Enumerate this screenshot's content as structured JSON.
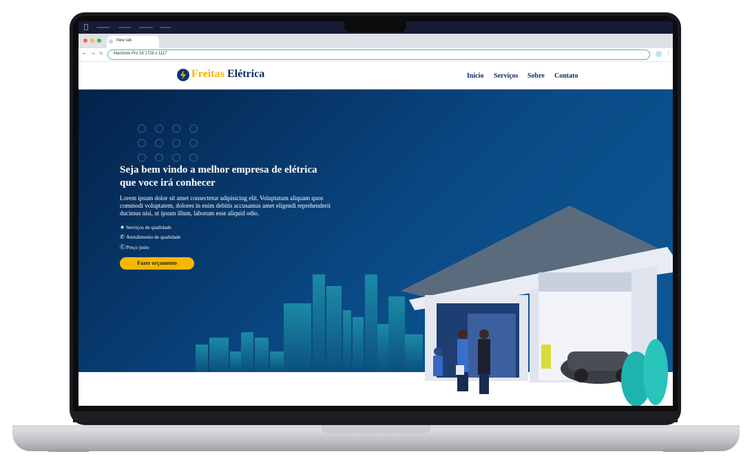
{
  "browser": {
    "tab_title": "New tab",
    "url": "Macbook Pro 16  1728 x 1117"
  },
  "site": {
    "logo": {
      "part1": "Freitas",
      "part2": "Elétrica"
    },
    "nav": [
      "Inicio",
      "Serviços",
      "Sobre",
      "Contato"
    ]
  },
  "hero": {
    "title": "Seja bem vindo a melhor empresa de elétrica que voce irá conhecer",
    "text": "Lorem ipsum dolor sit amet consectetur adipisicing elit. Voluptatum aliquam quos commodi voluptatem, dolores in enim debitis accusamus amet eligendi reprehenderit ducimus nisi, ut ipsum illum, laborum esse aliquid odio.",
    "features": [
      {
        "icon": "star-icon",
        "label": "Serviços de qualidade"
      },
      {
        "icon": "phone-icon",
        "label": "Atendimento de qualidade"
      },
      {
        "icon": "dollar-icon",
        "label": "Preço justo"
      }
    ],
    "cta": "Fazer orçamento"
  },
  "colors": {
    "hero_dark": "#04224a",
    "hero_light": "#0c5a97",
    "brand_yellow": "#f2b400",
    "brand_navy": "#0c2b66",
    "cta": "#f5b800"
  }
}
